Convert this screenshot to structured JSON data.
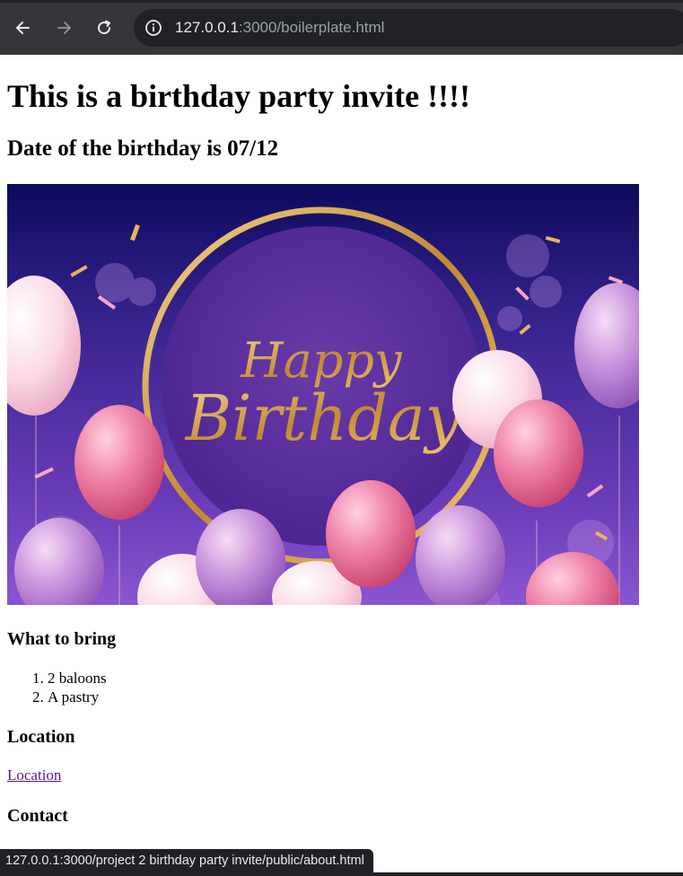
{
  "browser": {
    "url_host": "127.0.0.1",
    "url_path": ":3000/boilerplate.html",
    "status_url": "127.0.0.1:3000/project 2 birthday party invite/public/about.html"
  },
  "page": {
    "title": "This is a birthday party invite !!!!",
    "date_heading": "Date of the birthday is 07/12",
    "hero_image_text": [
      "Happy",
      "Birthday"
    ],
    "bring_heading": "What to bring",
    "bring_items": [
      "2 baloons",
      "A pastry"
    ],
    "location_heading": "Location",
    "location_link": "Location",
    "contact_heading": "Contact"
  },
  "colors": {
    "chrome_bg": "#35363a",
    "omnibox_bg": "#202124",
    "visited_link": "#551a8b",
    "hero_purple": "#5a2a9a",
    "ring_gold": "#c9943a"
  }
}
